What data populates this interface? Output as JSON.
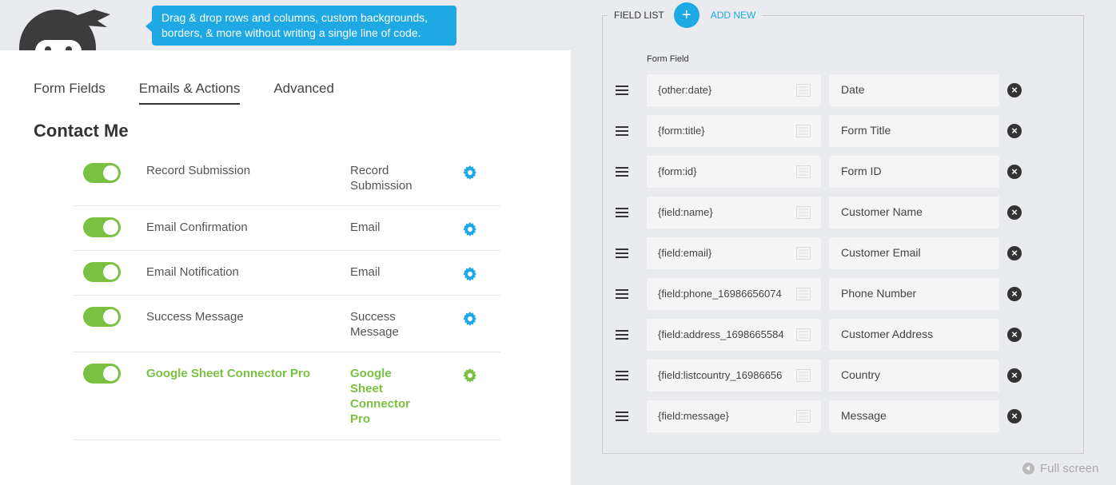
{
  "banner": {
    "tooltip": "Drag & drop rows and columns, custom backgrounds, borders, & more without writing a single line of code."
  },
  "tabs": [
    {
      "label": "Form Fields"
    },
    {
      "label": "Emails & Actions",
      "active": true
    },
    {
      "label": "Advanced"
    }
  ],
  "page_title": "Contact Me",
  "actions": [
    {
      "name": "Record Submission",
      "type": "Record Submission",
      "enabled": true
    },
    {
      "name": "Email Confirmation",
      "type": "Email",
      "enabled": true
    },
    {
      "name": "Email Notification",
      "type": "Email",
      "enabled": true
    },
    {
      "name": "Success Message",
      "type": "Success Message",
      "enabled": true
    },
    {
      "name": "Google Sheet Connector Pro",
      "type": "Google Sheet Connector Pro",
      "enabled": true
    }
  ],
  "field_list": {
    "title": "FIELD LIST",
    "add_icon": "+",
    "add_label": "ADD NEW",
    "column_header": "Form Field",
    "rows": [
      {
        "tag": "{other:date}",
        "name": "Date"
      },
      {
        "tag": "{form:title}",
        "name": "Form Title"
      },
      {
        "tag": "{form:id}",
        "name": "Form ID"
      },
      {
        "tag": "{field:name}",
        "name": "Customer Name"
      },
      {
        "tag": "{field:email}",
        "name": "Customer Email"
      },
      {
        "tag": "{field:phone_16986656074",
        "name": "Phone Number"
      },
      {
        "tag": "{field:address_1698665584",
        "name": "Customer Address"
      },
      {
        "tag": "{field:listcountry_16986656",
        "name": "Country"
      },
      {
        "tag": "{field:message}",
        "name": "Message"
      }
    ],
    "delete_glyph": "×"
  },
  "fullscreen_label": "Full screen",
  "colors": {
    "accent": "#1ea9e4",
    "toggle_on": "#7ac142",
    "pro_green": "#7ac142"
  }
}
